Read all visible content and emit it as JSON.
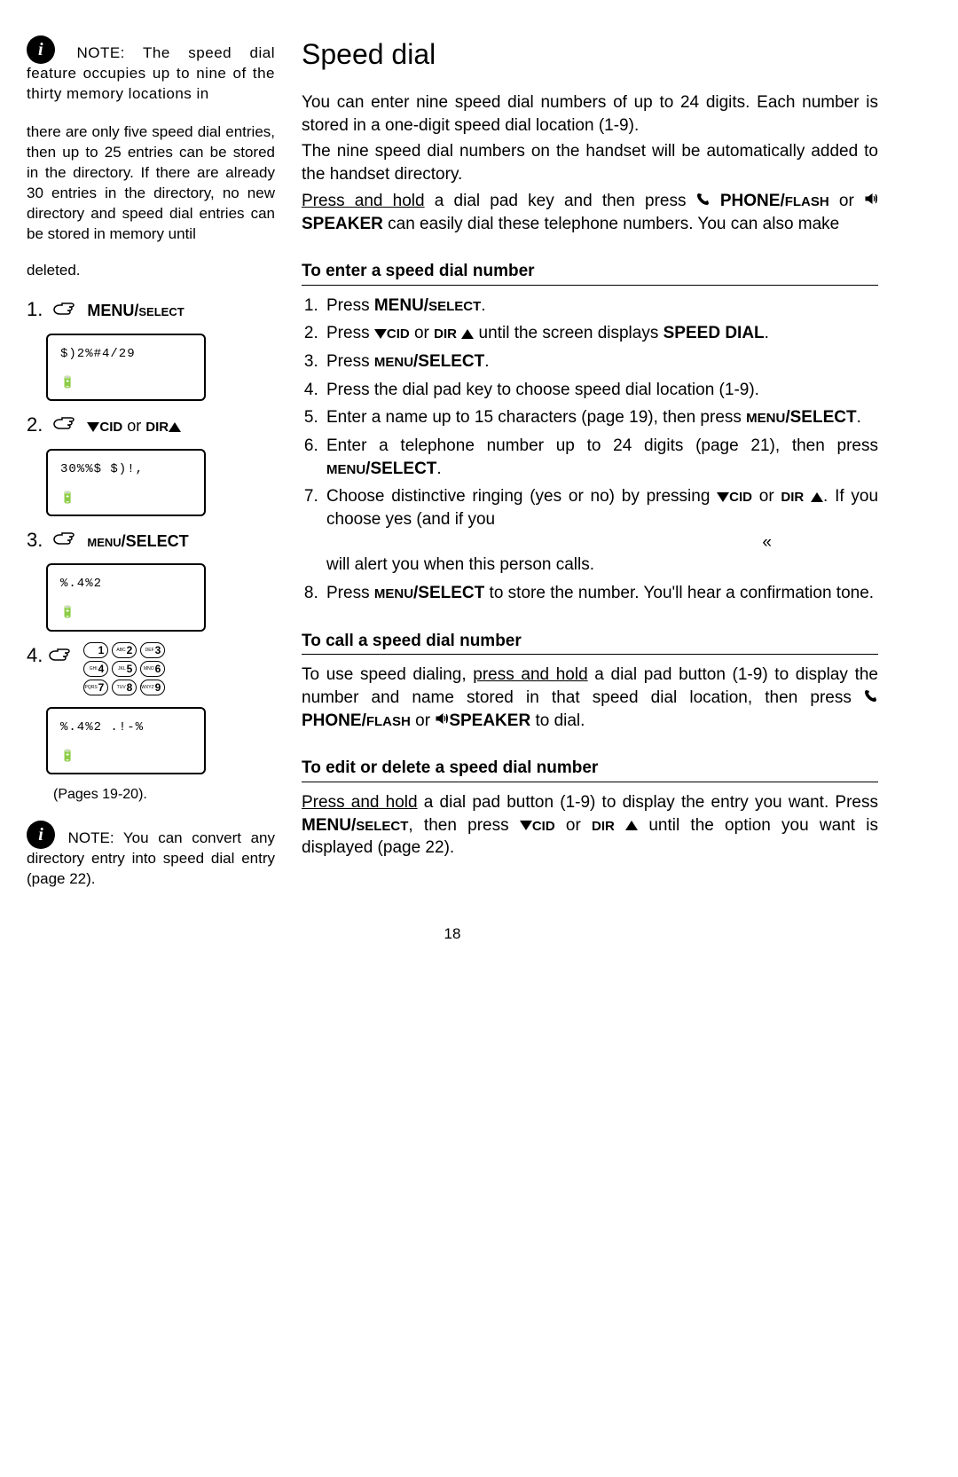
{
  "page_number": "18",
  "sidebar": {
    "note1_prefix": "NOTE:",
    "note1_a": "The speed dial feature occupies up to nine of the thirty memory locations in",
    "note1_b": "there are only five speed dial entries, then up to 25 entries can be stored in the directory. If there are already 30 entries in the directory, no new directory and speed dial entries can be stored in memory until",
    "note1_c": "deleted.",
    "step1_label": "MENU/",
    "step1_label2": "SELECT",
    "screen1_l1": "$)2%#4/29",
    "step2_cid": "CID",
    "step2_or": "or",
    "step2_dir": "DIR",
    "screen2_l1": "30%%$ $)!,",
    "step3_label": "MENU",
    "step3_label2": "/SELECT",
    "screen3_l1": "%.4%2",
    "screen4_l1": "%.4%2 .!-%",
    "ref": "(Pages 19-20).",
    "note2_prefix": "NOTE:",
    "note2": "You can convert any directory entry into speed dial entry (page 22).",
    "batt": "🔋"
  },
  "main": {
    "title": "Speed dial",
    "p1": "You can enter nine speed dial numbers of up to 24 digits. Each number is stored in a one-digit speed dial location (1-9).",
    "p2": "The nine speed dial numbers on the handset will be automatically added to the handset directory.",
    "p3_a": "Press and hold",
    "p3_b": " a dial pad key and then press ",
    "phone_flash": "PHONE/",
    "flash": "FLASH",
    "or1": " or ",
    "speaker": "SPEAKER",
    "p3_c": " can easily dial these telephone numbers. You can also make",
    "sect1": "To enter a speed dial number",
    "s1": "Press ",
    "s1b": "MENU/",
    "s1c": "SELECT",
    "s1d": ".",
    "s2a": "Press ",
    "s2cid": "CID",
    "s2or": " or ",
    "s2dir": "DIR",
    "s2b": " until the screen  displays ",
    "s2c": "SPEED DIAL",
    "s2d": ".",
    "s3a": "Press ",
    "s3b": "MENU",
    "s3c": "/SELECT",
    "s3d": ".",
    "s4": "Press the dial pad key to choose speed dial location (1-9).",
    "s5a": "Enter a name up to 15 characters (page 19), then press ",
    "s5b": "MENU",
    "s5c": "/SELECT",
    "s5d": ".",
    "s6a": "Enter a telephone number up to 24 digits (page 21), then press ",
    "s6b": "MENU",
    "s6c": "/SELECT",
    "s6d": ".",
    "s7a": "Choose distinctive ringing (yes or no) by pressing ",
    "s7cid": "CID",
    "s7or": " or ",
    "s7dir": "DIR",
    "s7b": ". If you choose yes (and if you",
    "s7c": "will alert you when this person calls.",
    "quote": "«",
    "s8a": "Press ",
    "s8b": "MENU",
    "s8c": "/SELECT",
    "s8d": " to store the number. You'll hear a confirmation tone.",
    "sect2": "To call a speed dial number",
    "p4a": "To use speed dialing, ",
    "p4u": "press and hold",
    "p4b": " a dial pad button (1-9) to display the number and name stored in that speed dial location, then press ",
    "p4c": " to dial.",
    "or2": " or ",
    "sect3": "To edit or delete a speed dial number",
    "p5a": "Press and hold",
    "p5b": " a dial pad button (1-9) to display the entry you want. Press ",
    "p5ms": "MENU/",
    "p5sel": "SELECT",
    "p5c": ", then press ",
    "p5cid": "CID",
    "p5or": " or ",
    "p5dir": "DIR",
    "p5d": " until the option you want is displayed (page 22)."
  }
}
